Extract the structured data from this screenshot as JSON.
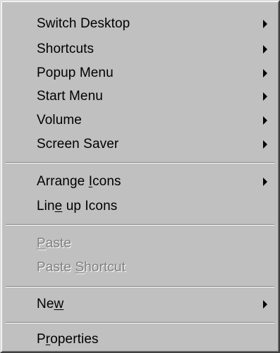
{
  "context_menu": {
    "groups": [
      {
        "items": [
          {
            "label": "Switch Desktop",
            "has_submenu": true,
            "enabled": true
          },
          {
            "label": "Shortcuts",
            "has_submenu": true,
            "enabled": true
          },
          {
            "label": "Popup Menu",
            "has_submenu": true,
            "enabled": true
          },
          {
            "label": "Start Menu",
            "has_submenu": true,
            "enabled": true
          },
          {
            "label": "Volume",
            "has_submenu": true,
            "enabled": true
          },
          {
            "label": "Screen Saver",
            "has_submenu": true,
            "enabled": true
          }
        ]
      },
      {
        "items": [
          {
            "label_before": "Arrange ",
            "label_accel": "I",
            "label_after": "cons",
            "has_submenu": true,
            "enabled": true
          },
          {
            "label_before": "Lin",
            "label_accel": "e",
            "label_after": " up Icons",
            "has_submenu": false,
            "enabled": true
          }
        ]
      },
      {
        "items": [
          {
            "label_before": "",
            "label_accel": "P",
            "label_after": "aste",
            "has_submenu": false,
            "enabled": false
          },
          {
            "label_before": "Paste ",
            "label_accel": "S",
            "label_after": "hortcut",
            "has_submenu": false,
            "enabled": false
          }
        ]
      },
      {
        "items": [
          {
            "label_before": "Ne",
            "label_accel": "w",
            "label_after": "",
            "has_submenu": true,
            "enabled": true
          }
        ]
      },
      {
        "items": [
          {
            "label_before": "P",
            "label_accel": "r",
            "label_after": "operties",
            "has_submenu": false,
            "enabled": true
          }
        ]
      }
    ]
  },
  "colors": {
    "menu_face": "#c0c0c0",
    "text": "#000000",
    "disabled_text": "#808080",
    "highlight": "#ffffff",
    "shadow": "#808080"
  }
}
